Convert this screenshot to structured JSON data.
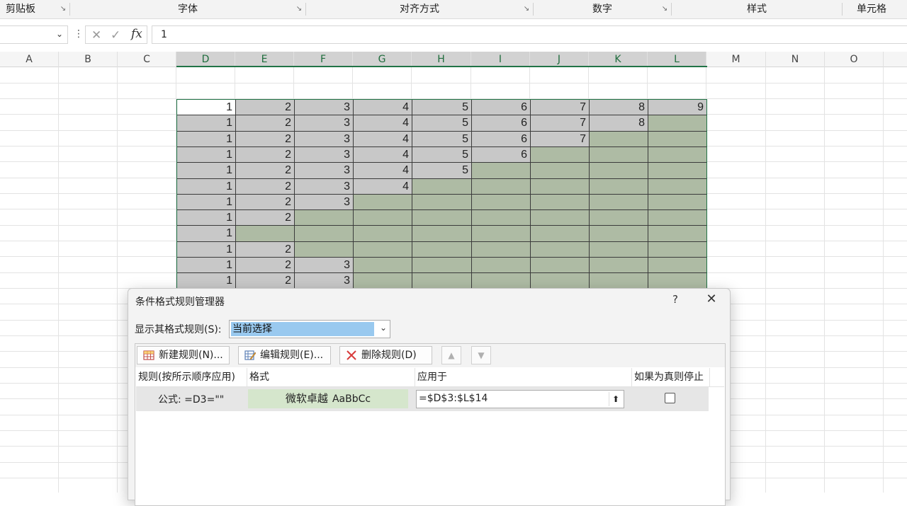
{
  "ribbon": {
    "groups": [
      {
        "label": "剪贴板",
        "has_launcher": true
      },
      {
        "label": "字体",
        "has_launcher": true
      },
      {
        "label": "对齐方式",
        "has_launcher": true
      },
      {
        "label": "数字",
        "has_launcher": true
      },
      {
        "label": "样式",
        "has_launcher": false
      },
      {
        "label": "单元格",
        "has_launcher": false
      }
    ],
    "launcher_glyph": "↘"
  },
  "formula_bar": {
    "name_box_value": "",
    "cancel_glyph": "✕",
    "enter_glyph": "✓",
    "fx_label": "fx",
    "content": "1"
  },
  "sheet": {
    "columns": [
      "A",
      "B",
      "C",
      "D",
      "E",
      "F",
      "G",
      "H",
      "I",
      "J",
      "K",
      "L",
      "M",
      "N",
      "O"
    ],
    "selected_columns": [
      "D",
      "E",
      "F",
      "G",
      "H",
      "I",
      "J",
      "K",
      "L"
    ],
    "rows": [
      [
        1,
        2,
        3,
        4,
        5,
        6,
        7,
        8,
        9
      ],
      [
        1,
        2,
        3,
        4,
        5,
        6,
        7,
        8,
        null
      ],
      [
        1,
        2,
        3,
        4,
        5,
        6,
        7,
        null,
        null
      ],
      [
        1,
        2,
        3,
        4,
        5,
        6,
        null,
        null,
        null
      ],
      [
        1,
        2,
        3,
        4,
        5,
        null,
        null,
        null,
        null
      ],
      [
        1,
        2,
        3,
        4,
        null,
        null,
        null,
        null,
        null
      ],
      [
        1,
        2,
        3,
        null,
        null,
        null,
        null,
        null,
        null
      ],
      [
        1,
        2,
        null,
        null,
        null,
        null,
        null,
        null,
        null
      ],
      [
        1,
        null,
        null,
        null,
        null,
        null,
        null,
        null,
        null
      ],
      [
        1,
        2,
        null,
        null,
        null,
        null,
        null,
        null,
        null
      ],
      [
        1,
        2,
        3,
        null,
        null,
        null,
        null,
        null,
        null
      ],
      [
        1,
        2,
        3,
        null,
        null,
        null,
        null,
        null,
        null
      ]
    ],
    "colors": {
      "value_fill": "#c8c8c8",
      "blank_fill": "#aebba4",
      "selection": "#217346"
    }
  },
  "dialog": {
    "title": "条件格式规则管理器",
    "help_glyph": "?",
    "close_glyph": "✕",
    "show_rules_label": "显示其格式规则(S):",
    "show_rules_value": "当前选择",
    "toolbar": {
      "new_rule": "新建规则(N)...",
      "edit_rule": "编辑规则(E)...",
      "delete_rule": "删除规则(D)",
      "move_up_glyph": "▲",
      "move_down_glyph": "▼"
    },
    "columns": {
      "rule": "规则(按所示顺序应用)",
      "format": "格式",
      "applies_to": "应用于",
      "stop_if_true": "如果为真则停止"
    },
    "rules": [
      {
        "rule": "公式: =D3=\"\"",
        "format_preview": "微软卓越",
        "format_sample": "AaBbCc",
        "applies_to": "=$D$3:$L$14",
        "stop_if_true": false
      }
    ]
  }
}
